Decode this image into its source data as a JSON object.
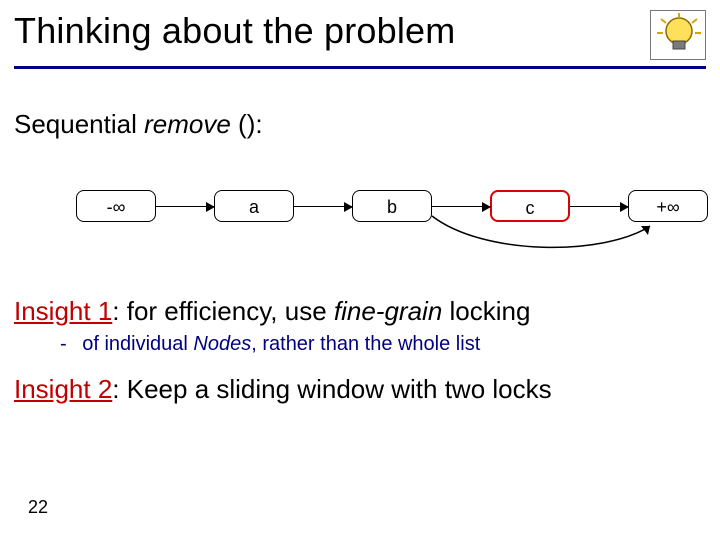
{
  "title": "Thinking about the problem",
  "subtitle_prefix": "Sequential ",
  "subtitle_ital": "remove ",
  "subtitle_suffix": "():",
  "nodes": {
    "neg_inf": "-∞",
    "a": "a",
    "b": "b",
    "c": "c",
    "pos_inf": "+∞"
  },
  "insight1": {
    "label": "Insight 1",
    "rest_1": ": for efficiency, use ",
    "ital": "fine-grain",
    "rest_2": " locking"
  },
  "sub1": {
    "dash": "-",
    "pre": "of individual ",
    "ital": "Nodes",
    "post": ", rather than the whole list"
  },
  "insight2": {
    "label": "Insight 2",
    "rest": ": Keep a sliding window with two locks"
  },
  "pagenum": "22",
  "icon": "lightbulb-icon"
}
